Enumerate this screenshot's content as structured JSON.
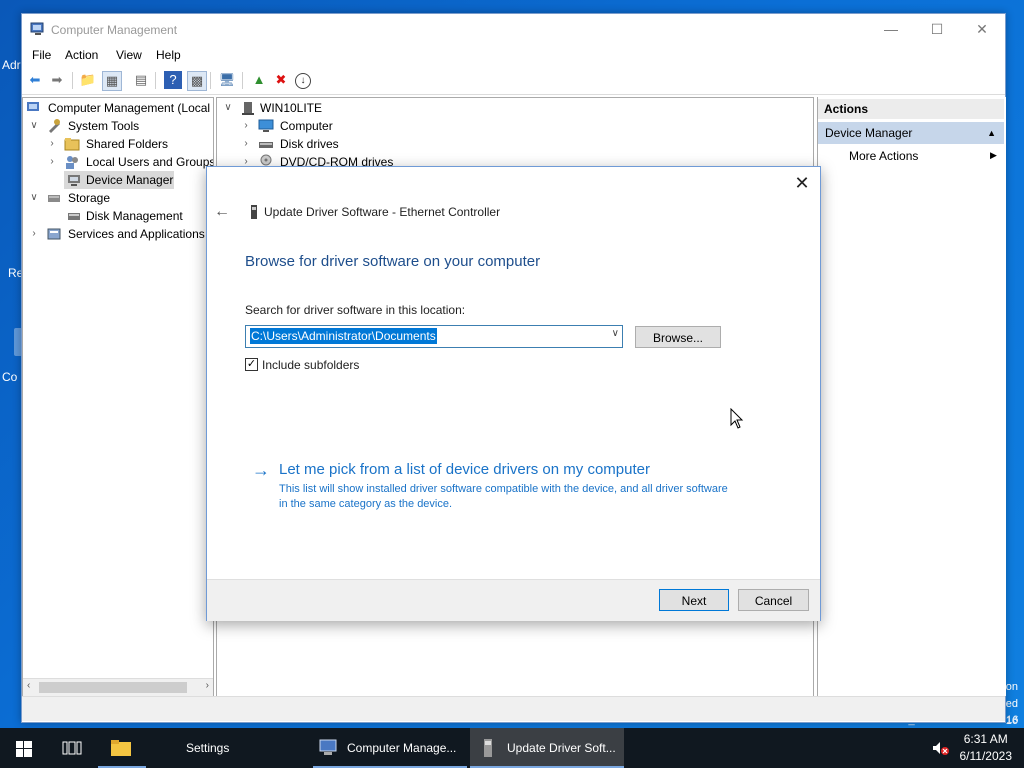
{
  "desktop": {
    "labels": [
      "Adr",
      "Re",
      "Co"
    ],
    "watermark_lines": [
      "on",
      "ed",
      "16"
    ],
    "build": "Build 14393.rs1_release.160715-1616"
  },
  "window": {
    "title": "Computer Management",
    "menu": [
      "File",
      "Action",
      "View",
      "Help"
    ]
  },
  "tree": {
    "root": "Computer Management (Local",
    "system_tools": "System Tools",
    "shared_folders": "Shared Folders",
    "local_users": "Local Users and Groups",
    "device_manager": "Device Manager",
    "storage": "Storage",
    "disk_management": "Disk Management",
    "services": "Services and Applications"
  },
  "devices": {
    "host": "WIN10LITE",
    "items": [
      "Computer",
      "Disk drives",
      "DVD/CD-ROM drives"
    ]
  },
  "actions": {
    "header": "Actions",
    "section": "Device Manager",
    "more": "More Actions"
  },
  "dialog": {
    "title": "Update Driver Software - Ethernet Controller",
    "heading": "Browse for driver software on your computer",
    "search_label": "Search for driver software in this location:",
    "path": "C:\\Users\\Administrator\\Documents",
    "browse": "Browse...",
    "include_subfolders": "Include subfolders",
    "link_title": "Let me pick from a list of device drivers on my computer",
    "link_desc": "This list will show installed driver software compatible with the device, and all driver software in the same category as the device.",
    "next": "Next",
    "cancel": "Cancel"
  },
  "taskbar": {
    "settings": "Settings",
    "computer_management": "Computer Manage...",
    "update_driver": "Update Driver Soft...",
    "time": "6:31 AM",
    "date": "6/11/2023"
  }
}
